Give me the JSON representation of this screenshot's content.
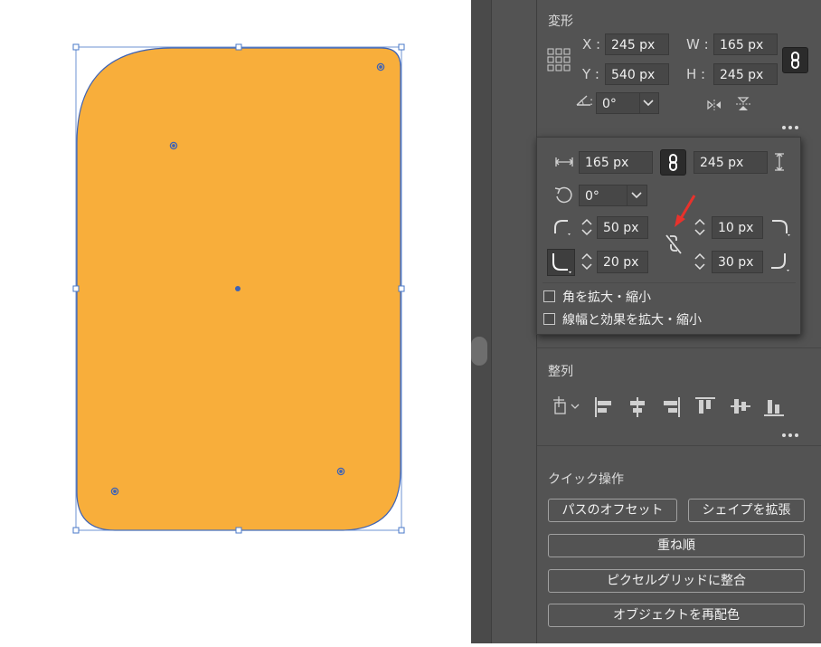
{
  "transform": {
    "title": "変形",
    "x_label": "X :",
    "x_value": "245 px",
    "y_label": "Y :",
    "y_value": "540 px",
    "w_label": "W :",
    "w_value": "165 px",
    "h_label": "H :",
    "h_value": "245 px",
    "angle_value": "0°"
  },
  "popup": {
    "width_value": "165 px",
    "height_value": "245 px",
    "rotate_value": "0°",
    "corner_tl": "50 px",
    "corner_tr": "10 px",
    "corner_bl": "20 px",
    "corner_br": "30 px",
    "scale_corners_label": "角を拡大・縮小",
    "scale_strokes_label": "線幅と効果を拡大・縮小"
  },
  "align": {
    "title": "整列"
  },
  "quick_actions": {
    "title": "クイック操作",
    "offset_path": "パスのオフセット",
    "expand_shape": "シェイプを拡張",
    "arrange": "重ね順",
    "align_pixel_grid": "ピクセルグリッドに整合",
    "recolor": "オブジェクトを再配色"
  },
  "colors": {
    "shape_fill": "#F8AE3B",
    "selection": "#3E63B5",
    "panel_bg": "#535353",
    "annotation_arrow": "#E8322C"
  }
}
